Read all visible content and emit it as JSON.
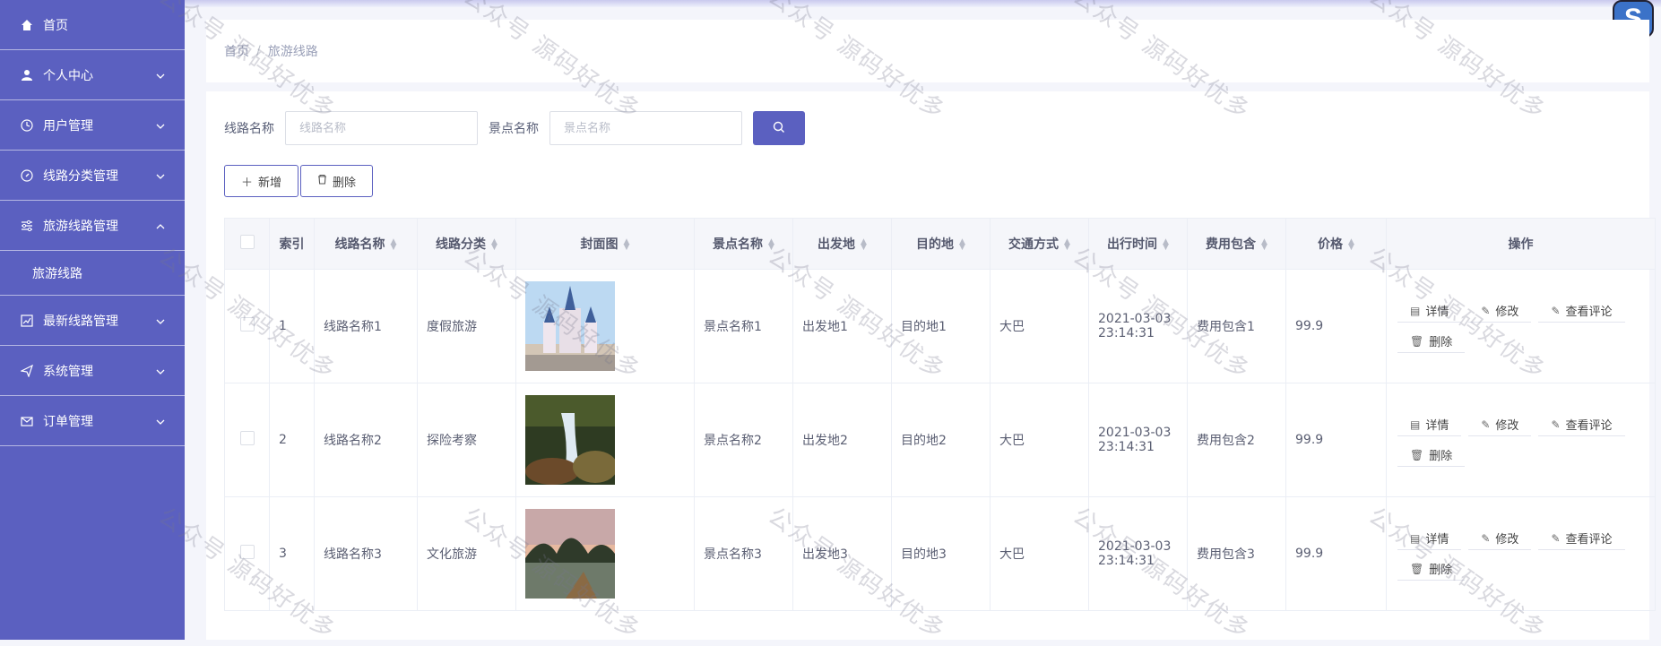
{
  "sidebar": {
    "items": [
      {
        "label": "首页",
        "icon": "home-icon"
      },
      {
        "label": "个人中心",
        "icon": "user-icon"
      },
      {
        "label": "用户管理",
        "icon": "clock-icon"
      },
      {
        "label": "线路分类管理",
        "icon": "compass-icon"
      },
      {
        "label": "旅游线路管理",
        "icon": "sliders-icon"
      },
      {
        "sub_label": "旅游线路"
      },
      {
        "label": "最新线路管理",
        "icon": "chart-icon"
      },
      {
        "label": "系统管理",
        "icon": "send-icon"
      },
      {
        "label": "订单管理",
        "icon": "mail-icon"
      }
    ]
  },
  "header": {
    "logo_letter": "S"
  },
  "breadcrumb": {
    "home": "首页",
    "sep": "/",
    "current": "旅游线路"
  },
  "search": {
    "route_label": "线路名称",
    "route_placeholder": "线路名称",
    "spot_label": "景点名称",
    "spot_placeholder": "景点名称"
  },
  "actions": {
    "add": "新增",
    "delete": "删除"
  },
  "table": {
    "headers": [
      "索引",
      "线路名称",
      "线路分类",
      "封面图",
      "景点名称",
      "出发地",
      "目的地",
      "交通方式",
      "出行时间",
      "费用包含",
      "价格",
      "操作"
    ],
    "rows": [
      {
        "index": "1",
        "route": "线路名称1",
        "category": "度假旅游",
        "spot": "景点名称1",
        "from": "出发地1",
        "to": "目的地1",
        "transport": "大巴",
        "time": "2021-03-03 23:14:31",
        "fee": "费用包含1",
        "price": "99.9"
      },
      {
        "index": "2",
        "route": "线路名称2",
        "category": "探险考察",
        "spot": "景点名称2",
        "from": "出发地2",
        "to": "目的地2",
        "transport": "大巴",
        "time": "2021-03-03 23:14:31",
        "fee": "费用包含2",
        "price": "99.9"
      },
      {
        "index": "3",
        "route": "线路名称3",
        "category": "文化旅游",
        "spot": "景点名称3",
        "from": "出发地3",
        "to": "目的地3",
        "transport": "大巴",
        "time": "2021-03-03 23:14:31",
        "fee": "费用包含3",
        "price": "99.9"
      }
    ],
    "ops": {
      "detail": "详情",
      "edit": "修改",
      "review": "查看评论",
      "delete": "删除"
    }
  },
  "watermark": "公众号 源码好优多",
  "colors": {
    "primary": "#5b60c0",
    "sidebar_bg": "#5b60c0"
  }
}
